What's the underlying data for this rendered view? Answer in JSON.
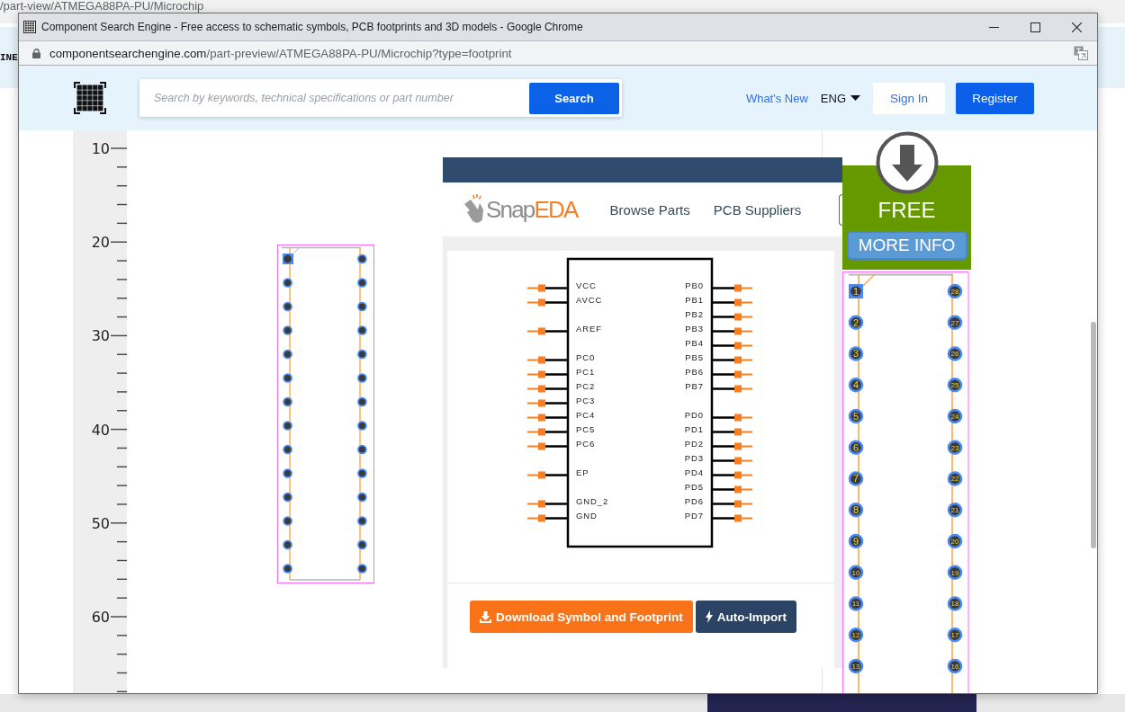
{
  "background_page": {
    "address_fragment": "/part-view/ATMEGA88PA-PU/Microchip",
    "side_text": "INE"
  },
  "window": {
    "title": "Component Search Engine - Free access to schematic symbols, PCB footprints and 3D models - Google Chrome",
    "url_host": "componentsearchengine.com",
    "url_path": "/part-preview/ATMEGA88PA-PU/Microchip?type=footprint"
  },
  "header": {
    "search": {
      "placeholder": "Search by keywords, technical specifications or part number"
    },
    "search_button": "Search",
    "links": [
      "What's New"
    ],
    "language": "ENG",
    "sign_in": "Sign In",
    "register": "Register"
  },
  "ruler": {
    "labels": [
      "10",
      "20",
      "30",
      "40",
      "50",
      "60"
    ]
  },
  "preview": {
    "logo": {
      "text": "Snap",
      "accent": "EDA"
    },
    "nav": [
      "Browse Parts",
      "PCB Suppliers"
    ],
    "symbol": {
      "left_pins": [
        [
          "VCC",
          "AVCC"
        ],
        [
          "AREF"
        ],
        [
          "PC0",
          "PC1",
          "PC2",
          "PC3",
          "PC4",
          "PC5",
          "PC6"
        ],
        [
          "EP"
        ],
        [
          "GND_2",
          "GND"
        ]
      ],
      "right_pins": [
        [
          "PB0",
          "PB1",
          "PB2",
          "PB3",
          "PB4",
          "PB5",
          "PB6",
          "PB7"
        ],
        [
          "PD0",
          "PD1",
          "PD2",
          "PD3",
          "PD4",
          "PD5",
          "PD6",
          "PD7"
        ]
      ]
    },
    "buttons": [
      {
        "label": "Download Symbol and Footprint",
        "kind": "download"
      },
      {
        "label": "Auto-Import",
        "kind": "auto_import"
      }
    ]
  },
  "ad": {
    "label": "FREE",
    "button": "MORE INFO"
  },
  "footprint": {
    "left_pads": [
      {
        "label": "1",
        "kind": "square"
      },
      {
        "label": "2",
        "kind": "round"
      },
      {
        "label": "3",
        "kind": "round"
      },
      {
        "label": "4",
        "kind": "round"
      },
      {
        "label": "5",
        "kind": "round"
      },
      {
        "label": "6",
        "kind": "round"
      },
      {
        "label": "7",
        "kind": "round"
      },
      {
        "label": "8",
        "kind": "round"
      },
      {
        "label": "9",
        "kind": "round"
      },
      {
        "label": "10",
        "kind": "round"
      },
      {
        "label": "11",
        "kind": "round"
      },
      {
        "label": "12",
        "kind": "round"
      },
      {
        "label": "13",
        "kind": "round"
      }
    ],
    "right_pads": [
      {
        "label": "28",
        "kind": "round"
      },
      {
        "label": "27",
        "kind": "round"
      },
      {
        "label": "26",
        "kind": "round"
      },
      {
        "label": "25",
        "kind": "round"
      },
      {
        "label": "24",
        "kind": "round"
      },
      {
        "label": "23",
        "kind": "round"
      },
      {
        "label": "22",
        "kind": "round"
      },
      {
        "label": "21",
        "kind": "round"
      },
      {
        "label": "20",
        "kind": "round"
      },
      {
        "label": "19",
        "kind": "round"
      },
      {
        "label": "18",
        "kind": "round"
      },
      {
        "label": "17",
        "kind": "round"
      },
      {
        "label": "16",
        "kind": "round"
      }
    ]
  }
}
